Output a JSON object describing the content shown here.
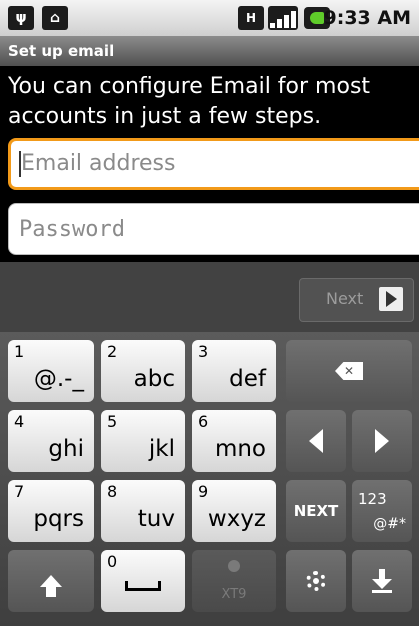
{
  "status_bar": {
    "time": "9:33 AM",
    "icons": [
      "usb-icon",
      "android-icon",
      "hplus-network-icon",
      "signal-icon",
      "battery-icon"
    ],
    "network_label": "H"
  },
  "header": {
    "title": "Set up email"
  },
  "intro_text": "You can configure Email for most accounts in just a few steps.",
  "form": {
    "email_placeholder": "Email address",
    "password_placeholder": "Password"
  },
  "button_bar": {
    "next_label": "Next"
  },
  "keyboard": {
    "row1": [
      {
        "num": "1",
        "label": "@.-_"
      },
      {
        "num": "2",
        "label": "abc"
      },
      {
        "num": "3",
        "label": "def"
      }
    ],
    "row2": [
      {
        "num": "4",
        "label": "ghi"
      },
      {
        "num": "5",
        "label": "jkl"
      },
      {
        "num": "6",
        "label": "mno"
      }
    ],
    "row3": [
      {
        "num": "7",
        "label": "pqrs"
      },
      {
        "num": "8",
        "label": "tuv"
      },
      {
        "num": "9",
        "label": "wxyz"
      }
    ],
    "next_key": "NEXT",
    "symbols_key_top": "123",
    "symbols_key_bottom": "@#*",
    "space_num": "0",
    "xt9_label": "XT9"
  },
  "colors": {
    "focus_border": "#f29a19",
    "background": "#000000",
    "battery": "#5fcc2a"
  }
}
